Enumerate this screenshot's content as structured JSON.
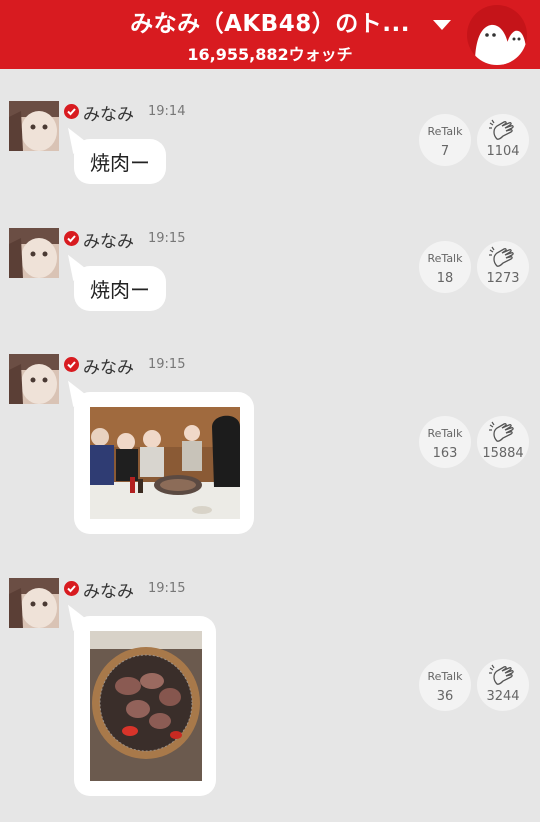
{
  "header": {
    "title": "みなみ（AKB48）のト...",
    "watch_count": "16,955,882ウォッチ",
    "dropdown_icon": "triangle-down-icon",
    "menu_icon": "mascot-icon",
    "brand_color": "#d81b20"
  },
  "posts": [
    {
      "name": "みなみ",
      "time": "19:14",
      "text": "焼肉ー",
      "retalk_label": "ReTalk",
      "retalk_count": "7",
      "clap_count": "1104"
    },
    {
      "name": "みなみ",
      "time": "19:15",
      "text": "焼肉ー",
      "retalk_label": "ReTalk",
      "retalk_count": "18",
      "clap_count": "1273"
    },
    {
      "name": "みなみ",
      "time": "19:15",
      "retalk_label": "ReTalk",
      "retalk_count": "163",
      "clap_count": "15884"
    },
    {
      "name": "みなみ",
      "time": "19:15",
      "retalk_label": "ReTalk",
      "retalk_count": "36",
      "clap_count": "3244"
    }
  ]
}
